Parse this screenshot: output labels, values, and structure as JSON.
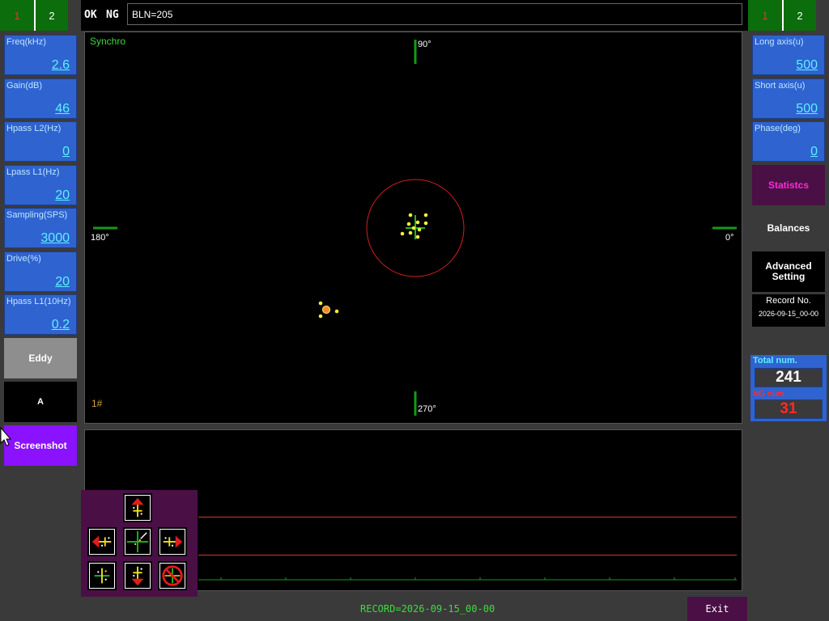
{
  "channels_left": [
    {
      "label": "1",
      "selected": true
    },
    {
      "label": "2",
      "selected": false
    }
  ],
  "channels_right": [
    {
      "label": "1",
      "selected": true
    },
    {
      "label": "2",
      "selected": false
    }
  ],
  "top": {
    "ok": "OK",
    "ng": "NG",
    "bln": "BLN=205"
  },
  "left_params": [
    {
      "label": "Freq(kHz)",
      "value": "2.6"
    },
    {
      "label": "Gain(dB)",
      "value": "46"
    },
    {
      "label": "Hpass L2(Hz)",
      "value": "0"
    },
    {
      "label": "Lpass L1(Hz)",
      "value": "20"
    },
    {
      "label": "Sampling(SPS)",
      "value": "3000"
    },
    {
      "label": "Drive(%)",
      "value": "20"
    },
    {
      "label": "Hpass L1(10Hz)",
      "value": "0.2"
    }
  ],
  "left_buttons": {
    "eddy": "Eddy",
    "a": "A",
    "screenshot": "Screenshot"
  },
  "right_params": [
    {
      "label": "Long axis(u)",
      "value": "500"
    },
    {
      "label": "Short axis(u)",
      "value": "500"
    },
    {
      "label": "Phase(deg)",
      "value": "0"
    }
  ],
  "right_buttons": {
    "statistics": "Statistcs",
    "balances": "Balances",
    "advanced": "Advanced Setting"
  },
  "record": {
    "title": "Record No.",
    "value": "2026-09-15_00-00"
  },
  "counts": {
    "total_label": "Total num.",
    "total_value": "241",
    "ng_label": "NG num.",
    "ng_value": "31"
  },
  "scope": {
    "mode": "Synchro",
    "probe": "1#",
    "deg90": "90°",
    "deg180": "180°",
    "deg0": "0°",
    "deg270": "270°"
  },
  "footer": {
    "record": "RECORD=2026-09-15_00-00",
    "exit": "Exit"
  },
  "colors": {
    "tab_green": "#0b6d0b",
    "param_blue": "#2e63d0",
    "value_cyan": "#5ff0ff",
    "statistics_text": "#ff2ad4",
    "screenshot_bg": "#8a12ff",
    "ng_red": "#ff2a2a"
  }
}
